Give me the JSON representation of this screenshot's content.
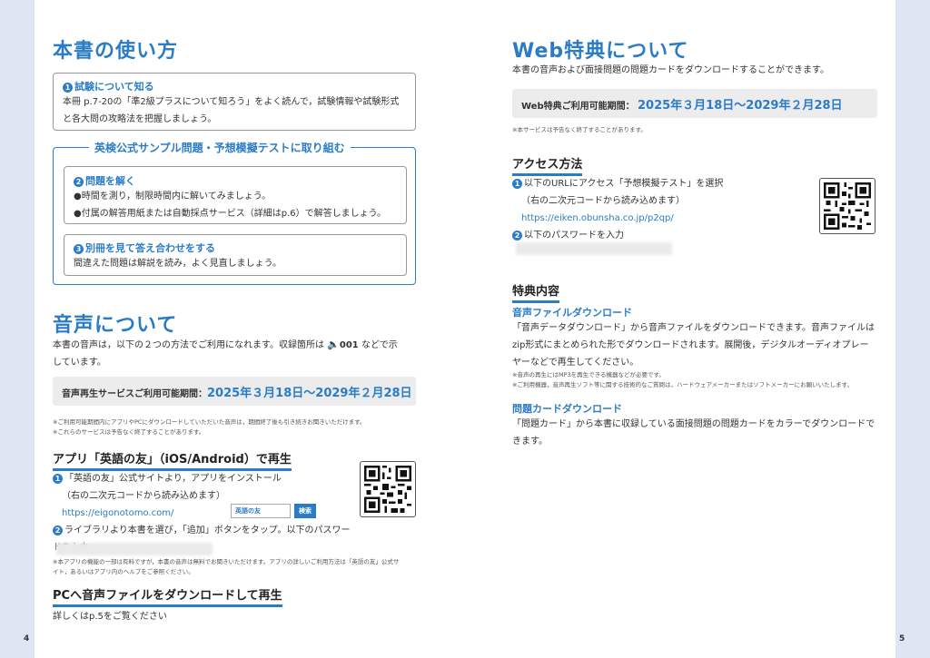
{
  "left": {
    "title": "本書の使い方",
    "box1": {
      "num": "1",
      "title": "試験について知る",
      "lines": [
        "本冊 p.7-20の「準2級プラスについて知ろう」をよく読んで，試験情報や試験形式",
        "と各大問の攻略法を把握しましょう。"
      ]
    },
    "section_title": "英検公式サンプル問題・予想模擬テストに取り組む",
    "box2": {
      "num": "2",
      "title": "問題を解く",
      "lines": [
        "●時間を測り，制限時間内に解いてみましょう。",
        "●付属の解答用紙または自動採点サービス（詳細はp.6）で解答しましょう。"
      ]
    },
    "box3": {
      "num": "3",
      "title": "別冊を見て答え合わせをする",
      "lines": [
        "間違えた問題は解説を読み，よく見直しましょう。"
      ]
    },
    "audio_title": "音声について",
    "audio_text_1a": "本書の音声は，以下の２つの方法でご利用になれます。収録箇所は",
    "audio_icon": "speaker-icon",
    "audio_code": "001",
    "audio_text_1b": "などで示",
    "audio_text_2": "しています。",
    "period_label": "音声再生サービスご利用可能期間：",
    "period_date": "2025年３月18日～2029年２月28日",
    "notes1": [
      "※ご利用可能期間内にアプリやPCにダウンロードしていただいた音声は，期間終了後も引き続きお聞きいただけます。",
      "※これらのサービスは予告なく終了することがあります。"
    ],
    "app_title": "アプリ「英語の友」（iOS/Android）で再生",
    "app_step1": "「英語の友」公式サイトより，アプリをインストール",
    "app_step1b": "（右の二次元コードから読み込めます）",
    "app_url": "https://eigonotomo.com/",
    "search_text": "英語の友",
    "search_button": "検索",
    "app_step2": "ライブラリより本書を選び，「追加」ボタンをタップ。以下のパスワードを入力",
    "notes2": [
      "※本アプリの機能の一部は有料ですが，本書の音声は無料でお聞きいただけます。アプリの詳しいご利用方法は「英語の友」公式サ",
      "イト，あるいはアプリ内のヘルプをご参照ください。"
    ],
    "pc_title": "PCへ音声ファイルをダウンロードして再生",
    "pc_text": "詳しくはp.5をご覧ください",
    "page_number": "4"
  },
  "right": {
    "title": "Web特典について",
    "intro": "本書の音声および面接問題の問題カードをダウンロードすることができます。",
    "period_label": "Web特典ご利用可能期間：",
    "period_date": "2025年３月18日～2029年２月28日",
    "note1": "※本サービスは予告なく終了することがあります。",
    "access_title": "アクセス方法",
    "access_step1": "以下のURLにアクセス「予想模擬テスト」を選択",
    "access_step1b": "（右の二次元コードから読み込めます）",
    "access_url": "https://eiken.obunsha.co.jp/p2qp/",
    "access_step2": "以下のパスワードを入力",
    "benefit_title": "特典内容",
    "audio_dl_title": "音声ファイルダウンロード",
    "audio_dl_lines": [
      "「音声データダウンロード」から音声ファイルをダウンロードできます。音声ファイルは",
      "zip形式にまとめられた形でダウンロードされます。展開後，デジタルオーディオプレー",
      "ヤーなどで再生してください。"
    ],
    "audio_dl_notes": [
      "※音声の再生にはMP3を再生できる機器などが必要です。",
      "※ご利用機器，音声再生ソフト等に関する技術的なご質問は，ハードウェアメーカーまたはソフトメーカーにお願いいたします。"
    ],
    "card_title": "問題カードダウンロード",
    "card_lines": [
      "「問題カード」から本書に収録している面接問題の問題カードをカラーでダウンロードで",
      "きます。"
    ],
    "page_number": "5"
  }
}
